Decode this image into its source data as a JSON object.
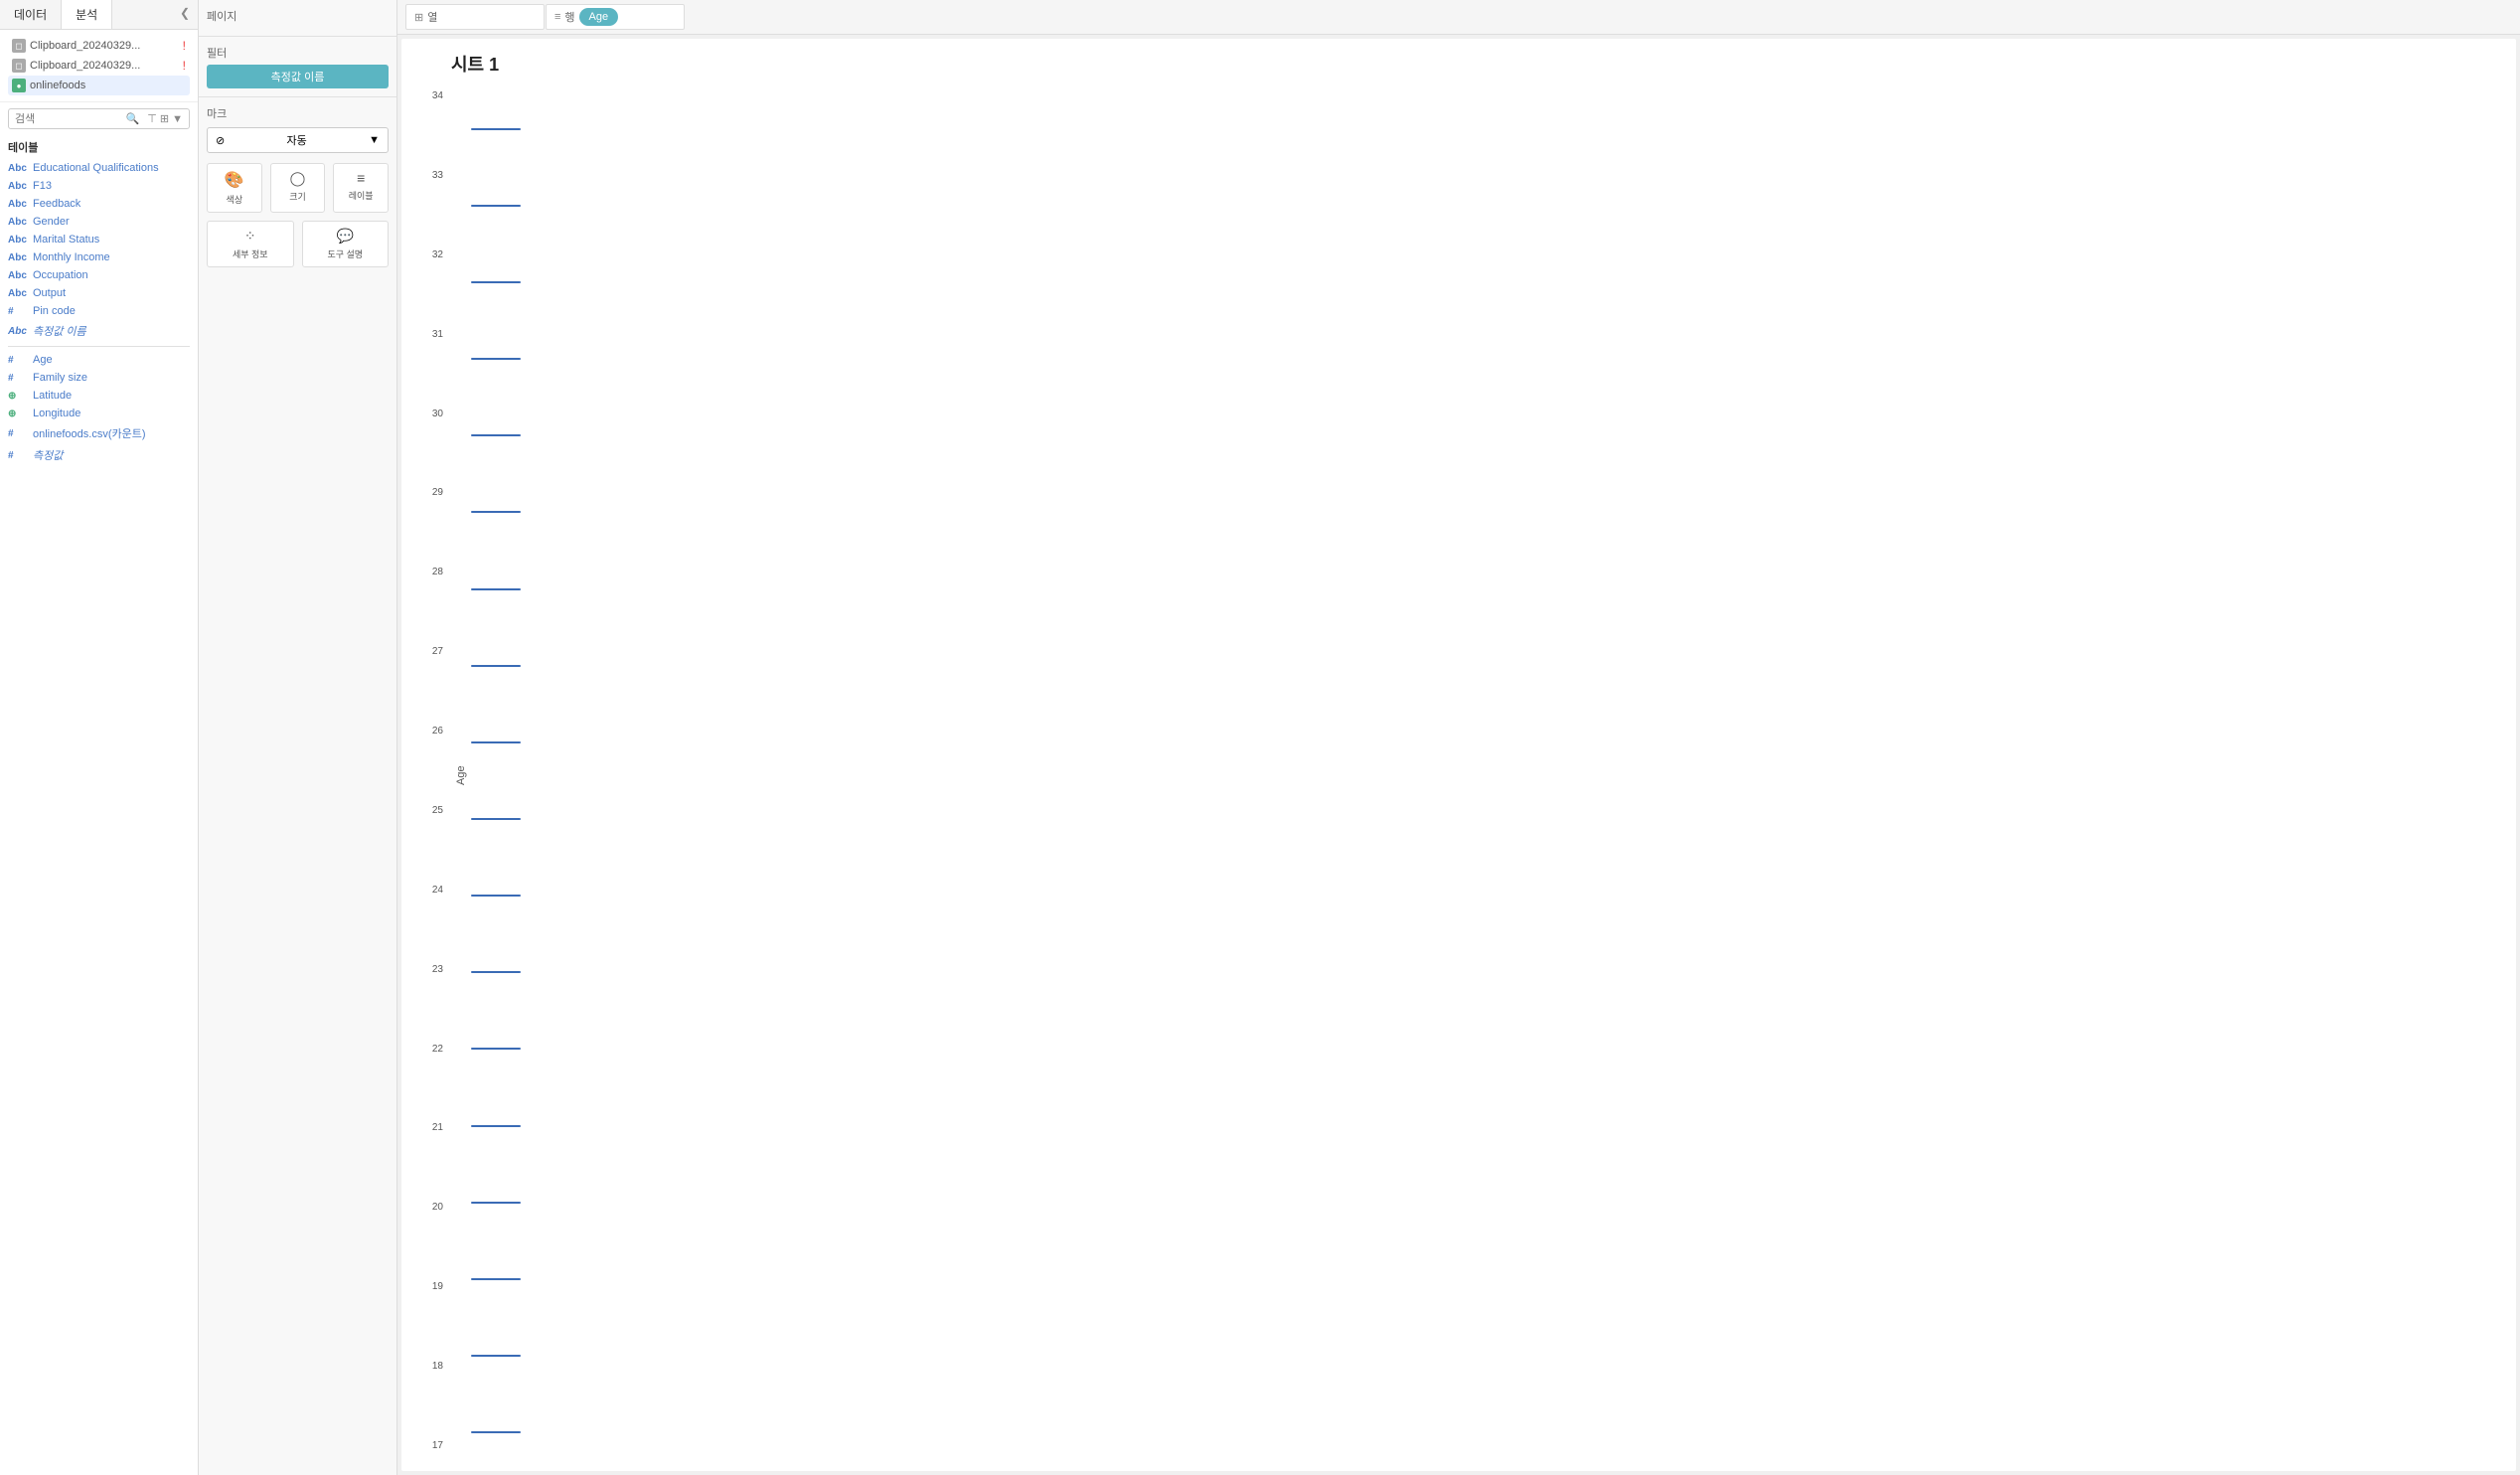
{
  "tabs": {
    "data_label": "데이터",
    "analysis_label": "분석",
    "close_icon": "❮"
  },
  "datasources": [
    {
      "id": "clipboard1",
      "name": "Clipboard_20240329...",
      "type": "clipboard",
      "error": true
    },
    {
      "id": "clipboard2",
      "name": "Clipboard_20240329...",
      "type": "clipboard",
      "error": true
    },
    {
      "id": "onlinefoods",
      "name": "onlinefoods",
      "type": "geo",
      "active": true
    }
  ],
  "search": {
    "placeholder": "검색"
  },
  "tables_section_label": "테이블",
  "fields": [
    {
      "type": "abc",
      "name": "Educational Qualifications"
    },
    {
      "type": "abc",
      "name": "F13"
    },
    {
      "type": "abc",
      "name": "Feedback"
    },
    {
      "type": "abc",
      "name": "Gender"
    },
    {
      "type": "abc",
      "name": "Marital Status"
    },
    {
      "type": "abc",
      "name": "Monthly Income"
    },
    {
      "type": "abc",
      "name": "Occupation"
    },
    {
      "type": "abc",
      "name": "Output"
    },
    {
      "type": "hash",
      "name": "Pin code"
    },
    {
      "type": "italic",
      "name": "측정값 이름"
    },
    {
      "type": "hash",
      "name": "Age"
    },
    {
      "type": "hash",
      "name": "Family size"
    },
    {
      "type": "geo",
      "name": "Latitude"
    },
    {
      "type": "geo",
      "name": "Longitude"
    },
    {
      "type": "hash",
      "name": "onlinefoods.csv(카운트)"
    },
    {
      "type": "hash",
      "name": "측정값"
    }
  ],
  "pages_label": "페이지",
  "filter_label": "필터",
  "filter_pill": "측정값 이름",
  "marks_label": "마크",
  "marks_dropdown": "자동",
  "marks_buttons": [
    {
      "id": "color",
      "icon": "🎨",
      "label": "색상"
    },
    {
      "id": "size",
      "icon": "◯",
      "label": "크기"
    },
    {
      "id": "label",
      "icon": "≡",
      "label": "레이블"
    },
    {
      "id": "detail",
      "icon": "⁘",
      "label": "세부 정보"
    },
    {
      "id": "tooltip",
      "icon": "💬",
      "label": "도구 설명"
    }
  ],
  "shelves": {
    "col_icon": "⊞",
    "col_label": "열",
    "row_icon": "≡",
    "row_label": "행",
    "pill": "Age"
  },
  "sheet": {
    "title": "시트 1"
  },
  "chart": {
    "y_axis_label": "Age",
    "rows": [
      34,
      33,
      32,
      31,
      30,
      29,
      28,
      27,
      26,
      25,
      24,
      23,
      22,
      21,
      20,
      19,
      18,
      17
    ]
  }
}
